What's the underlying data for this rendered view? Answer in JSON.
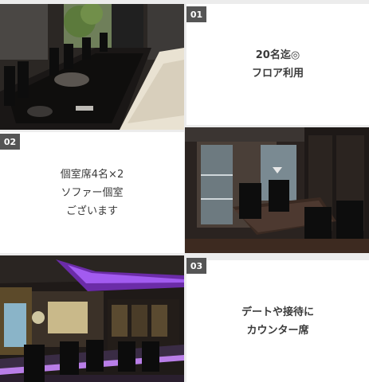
{
  "panels": [
    {
      "number": "01",
      "text": "20名迄◎\nフロア利用",
      "bold": true
    },
    {
      "number": "02",
      "text": "個室席4名×2\nソファー個室\nございます",
      "bold": false
    },
    {
      "number": "03",
      "text": "デートや接待に\nカウンター席",
      "bold": true
    }
  ],
  "colors": {
    "page_bg": "#ececec",
    "card_bg": "#ffffff",
    "badge_bg": "#555555",
    "text": "#3a3a3a"
  }
}
